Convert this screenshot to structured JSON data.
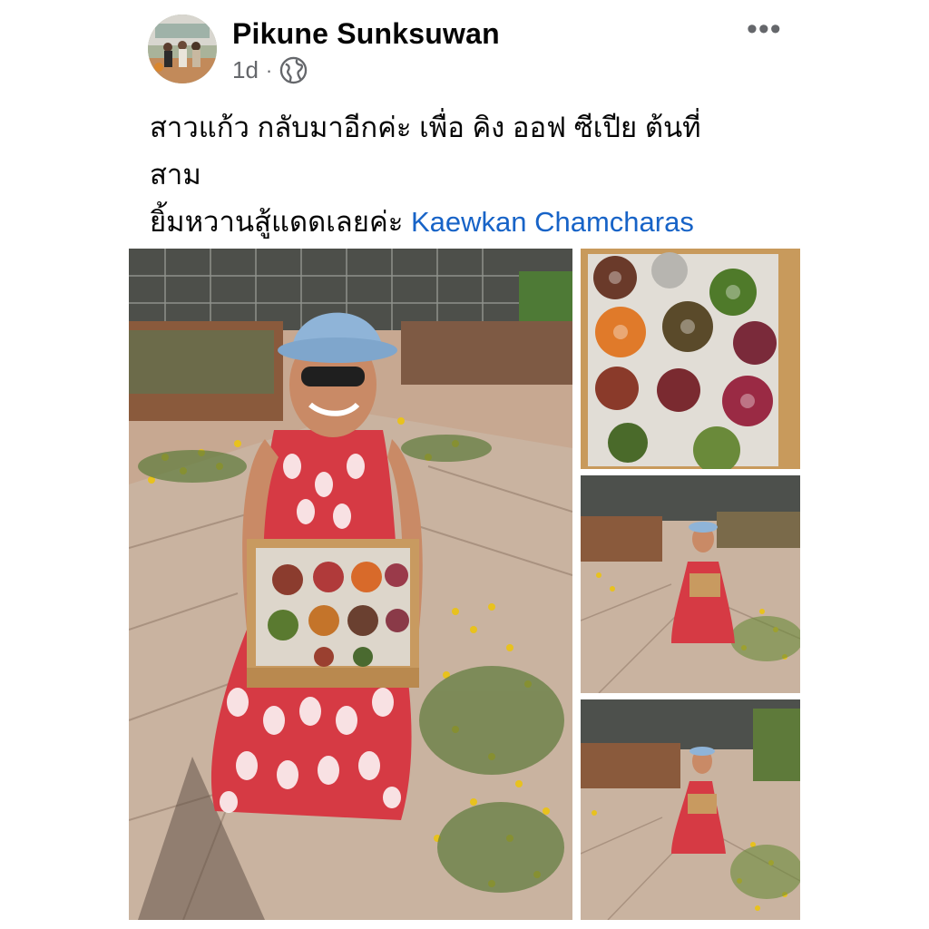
{
  "post": {
    "author": "Pikune Sunksuwan",
    "time": "1d",
    "separator": "·",
    "privacy_icon": "globe-icon",
    "more_icon": "more-icon",
    "caption_text": "สาวแก้ว กลับมาอีกค่ะ เพื่อ คิง ออฟ ซีเปีย ต้นที่\nสาม\nยิ้มหวานสู้แดดเลยค่ะ ",
    "mention": "Kaewkan Chamcharas"
  },
  "photos": [
    {
      "name": "main-photo",
      "subject": "woman kneeling holding wooden box of grafted cacti in garden"
    },
    {
      "name": "cactus-box-photo",
      "subject": "top view of wooden box with wrapped cactus pots"
    },
    {
      "name": "garden-photo-2",
      "subject": "woman kneeling with box in garden, wide view"
    },
    {
      "name": "garden-photo-3",
      "subject": "woman kneeling with box in garden, wider view"
    }
  ],
  "colors": {
    "author_text": "#050505",
    "meta_text": "#65676b",
    "mention_link": "#1763c7",
    "background": "#ffffff"
  }
}
